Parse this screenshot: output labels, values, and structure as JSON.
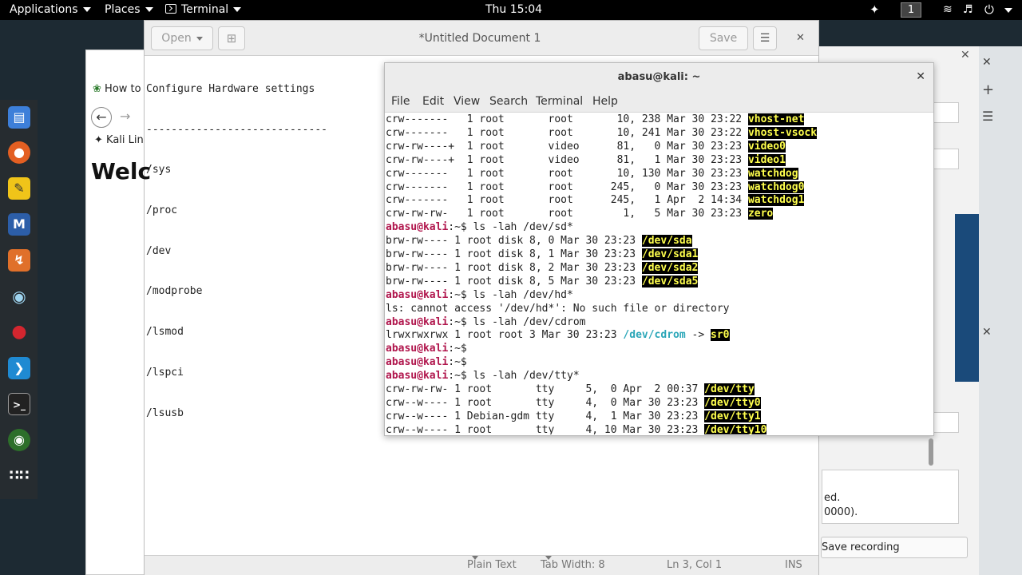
{
  "topbar": {
    "applications": "Applications",
    "places": "Places",
    "terminal": "Terminal",
    "clock": "Thu 15:04",
    "workspace": "1"
  },
  "gedit": {
    "open_label": "Open",
    "title": "*Untitled Document 1",
    "save_label": "Save",
    "lines": [
      "Configure Hardware settings",
      "-----------------------------",
      "/sys",
      "/proc",
      "/dev",
      "/modprobe",
      "/lsmod",
      "/lspci",
      "/lsusb"
    ],
    "status": {
      "language": "Plain Text",
      "tab_width": "Tab Width: 8",
      "position": "Ln 3, Col 1",
      "mode": "INS"
    }
  },
  "browser_frag": {
    "tab_text": "How to",
    "bookmark": "Kali Lin",
    "heading": "Welc"
  },
  "terminal": {
    "title": "abasu@kali: ~",
    "menu": [
      "File",
      "Edit",
      "View",
      "Search",
      "Terminal",
      "Help"
    ],
    "prompt_user": "abasu@kali",
    "prompt_sep": ":~$",
    "lines": [
      {
        "text": "crw-------   1 root       root       10, 238 Mar 30 23:22 ",
        "hl": "vhost-net"
      },
      {
        "text": "crw-------   1 root       root       10, 241 Mar 30 23:22 ",
        "hl": "vhost-vsock"
      },
      {
        "text": "crw-rw----+  1 root       video      81,   0 Mar 30 23:23 ",
        "hl": "video0"
      },
      {
        "text": "crw-rw----+  1 root       video      81,   1 Mar 30 23:23 ",
        "hl": "video1"
      },
      {
        "text": "crw-------   1 root       root       10, 130 Mar 30 23:23 ",
        "hl": "watchdog"
      },
      {
        "text": "crw-------   1 root       root      245,   0 Mar 30 23:23 ",
        "hl": "watchdog0"
      },
      {
        "text": "crw-------   1 root       root      245,   1 Apr  2 14:34 ",
        "hl": "watchdog1"
      },
      {
        "text": "crw-rw-rw-   1 root       root        1,   5 Mar 30 23:23 ",
        "hl": "zero"
      },
      {
        "prompt": true,
        "cmd": " ls -lah /dev/sd*"
      },
      {
        "text": "brw-rw---- 1 root disk 8, 0 Mar 30 23:23 ",
        "hl": "/dev/sda"
      },
      {
        "text": "brw-rw---- 1 root disk 8, 1 Mar 30 23:23 ",
        "hl": "/dev/sda1"
      },
      {
        "text": "brw-rw---- 1 root disk 8, 2 Mar 30 23:23 ",
        "hl": "/dev/sda2"
      },
      {
        "text": "brw-rw---- 1 root disk 8, 5 Mar 30 23:23 ",
        "hl": "/dev/sda5"
      },
      {
        "prompt": true,
        "cmd": " ls -lah /dev/hd*"
      },
      {
        "text": "ls: cannot access '/dev/hd*': No such file or directory"
      },
      {
        "prompt": true,
        "cmd": " ls -lah /dev/cdrom"
      },
      {
        "text": "lrwxrwxrwx 1 root root 3 Mar 30 23:23 ",
        "cy": "/dev/cdrom",
        "mid": " -> ",
        "hl": "sr0"
      },
      {
        "prompt": true,
        "cmd": ""
      },
      {
        "prompt": true,
        "cmd": ""
      },
      {
        "prompt": true,
        "cmd": " ls -lah /dev/tty*"
      },
      {
        "text": "crw-rw-rw- 1 root       tty     5,  0 Apr  2 00:37 ",
        "hl": "/dev/tty"
      },
      {
        "text": "crw--w---- 1 root       tty     4,  0 Mar 30 23:23 ",
        "hl": "/dev/tty0"
      },
      {
        "text": "crw--w---- 1 Debian-gdm tty     4,  1 Mar 30 23:23 ",
        "hl": "/dev/tty1"
      },
      {
        "text": "crw--w---- 1 root       tty     4, 10 Mar 30 23:23 ",
        "hl": "/dev/tty10"
      }
    ]
  },
  "bg_right": {
    "text_line1": "ed.",
    "text_line2": "0000).",
    "save_recording": "Save recording"
  },
  "colors": {
    "prompt": "#b0154c",
    "highlight_fg": "#ffff4d",
    "link_cyan": "#2aa6b8"
  }
}
